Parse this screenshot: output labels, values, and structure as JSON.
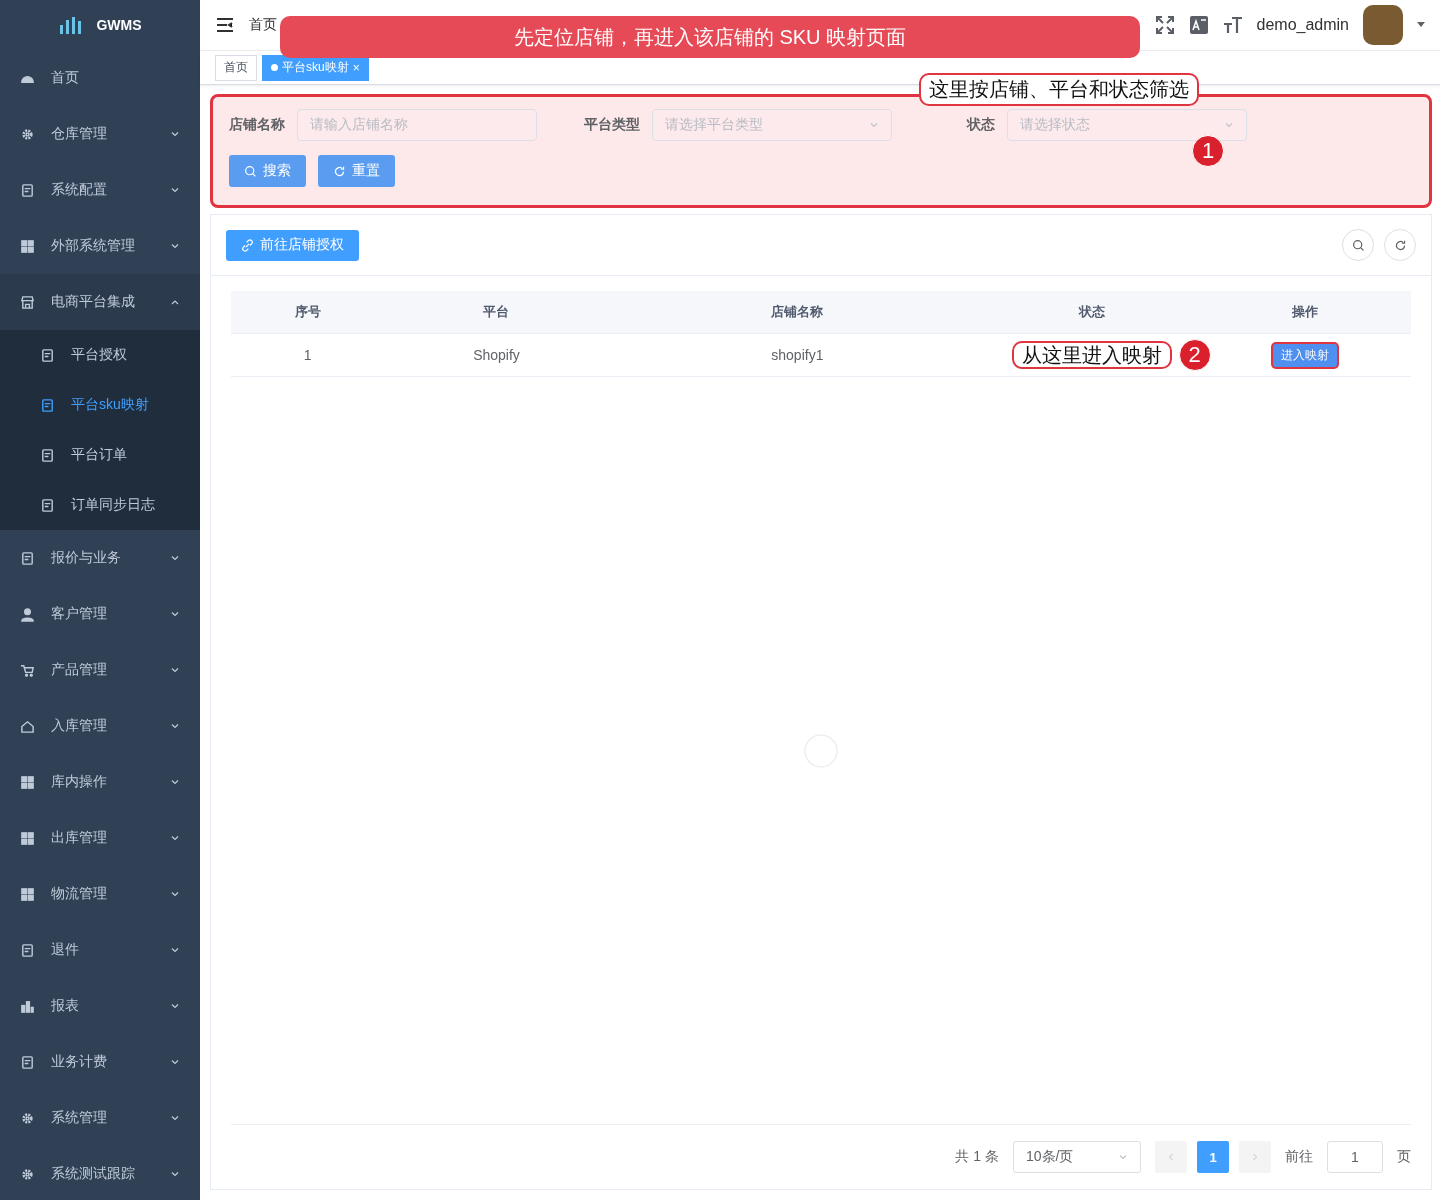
{
  "sidebar": {
    "logo": "GWMS",
    "items": [
      {
        "label": "首页",
        "kind": "link"
      },
      {
        "label": "仓库管理",
        "kind": "submenu",
        "expanded": false
      },
      {
        "label": "系统配置",
        "kind": "submenu",
        "expanded": false
      },
      {
        "label": "外部系统管理",
        "kind": "submenu",
        "expanded": false
      },
      {
        "label": "电商平台集成",
        "kind": "submenu",
        "expanded": true,
        "children": [
          {
            "label": "平台授权",
            "selected": false
          },
          {
            "label": "平台sku映射",
            "selected": true
          },
          {
            "label": "平台订单",
            "selected": false
          },
          {
            "label": "订单同步日志",
            "selected": false
          }
        ]
      },
      {
        "label": "报价与业务",
        "kind": "submenu",
        "expanded": false
      },
      {
        "label": "客户管理",
        "kind": "submenu",
        "expanded": false
      },
      {
        "label": "产品管理",
        "kind": "submenu",
        "expanded": false
      },
      {
        "label": "入库管理",
        "kind": "submenu",
        "expanded": false
      },
      {
        "label": "库内操作",
        "kind": "submenu",
        "expanded": false
      },
      {
        "label": "出库管理",
        "kind": "submenu",
        "expanded": false
      },
      {
        "label": "物流管理",
        "kind": "submenu",
        "expanded": false
      },
      {
        "label": "退件",
        "kind": "submenu",
        "expanded": false
      },
      {
        "label": "报表",
        "kind": "submenu",
        "expanded": false
      },
      {
        "label": "业务计费",
        "kind": "submenu",
        "expanded": false
      },
      {
        "label": "系统管理",
        "kind": "submenu",
        "expanded": false
      },
      {
        "label": "系统测试跟踪",
        "kind": "submenu",
        "expanded": false
      }
    ]
  },
  "header": {
    "breadcrumb": [
      "首页"
    ],
    "username": "demo_admin"
  },
  "tabs": [
    {
      "label": "首页",
      "selected": false
    },
    {
      "label": "平台sku映射",
      "selected": true,
      "close": "×"
    }
  ],
  "filters": [
    {
      "label": "店铺名称",
      "placeholder": "请输入店铺名称",
      "kind": "input"
    },
    {
      "label": "平台类型",
      "placeholder": "请选择平台类型",
      "kind": "select"
    },
    {
      "label": "状态",
      "placeholder": "请选择状态",
      "kind": "select"
    }
  ],
  "filter_buttons": [
    "搜索",
    "重置"
  ],
  "toolbar": {
    "button": "前往店铺授权"
  },
  "table": {
    "columns": [
      "序号",
      "平台",
      "店铺名称",
      "状态",
      "操作"
    ],
    "rows": [
      {
        "index": "1",
        "platform": "Shopify",
        "shop_name": "shopify1",
        "action": "进入映射"
      }
    ]
  },
  "pagination": {
    "total": "共 1 条",
    "page_size": "10条/页",
    "pages": [
      {
        "label": "1",
        "selected": true
      }
    ],
    "goto_label": "前往",
    "goto_value": "1",
    "page_suffix": "页"
  },
  "annotations": {
    "banner": "先定位店铺，再进入该店铺的 SKU 映射页面",
    "filter_note": "这里按店铺、平台和状态筛选",
    "filter_badge": "1",
    "row_note": "从这里进入映射",
    "action_badge": "2"
  }
}
